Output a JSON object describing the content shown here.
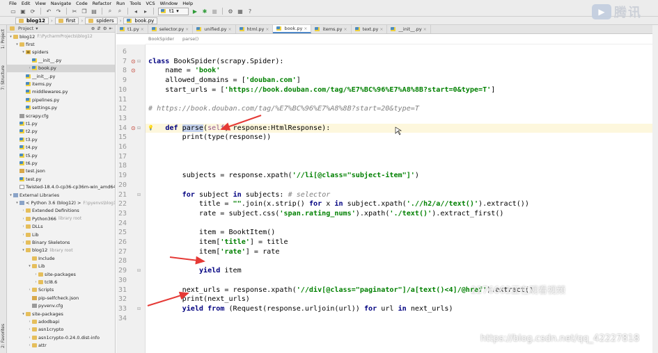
{
  "menu": [
    "File",
    "Edit",
    "View",
    "Navigate",
    "Code",
    "Refactor",
    "Run",
    "Tools",
    "VCS",
    "Window",
    "Help"
  ],
  "toolbar": {
    "run_config": "t1"
  },
  "nav": [
    "blog12",
    "first",
    "spiders",
    "book.py"
  ],
  "project": {
    "header": "Project",
    "items": [
      {
        "label": "blog12",
        "hint": "F:\\PycharmProjects\\blog12",
        "icon": "folder",
        "indent": 0,
        "arrow": "▾"
      },
      {
        "label": "first",
        "icon": "folder",
        "indent": 1,
        "arrow": "▾"
      },
      {
        "label": "spiders",
        "icon": "pkg",
        "indent": 2,
        "arrow": "▾"
      },
      {
        "label": "__init__.py",
        "icon": "py",
        "indent": 3,
        "arrow": ""
      },
      {
        "label": "book.py",
        "icon": "py",
        "indent": 3,
        "arrow": "›",
        "selected": true
      },
      {
        "label": "__init__.py",
        "icon": "py",
        "indent": 2,
        "arrow": ""
      },
      {
        "label": "items.py",
        "icon": "py",
        "indent": 2,
        "arrow": ""
      },
      {
        "label": "middlewares.py",
        "icon": "py",
        "indent": 2,
        "arrow": ""
      },
      {
        "label": "pipelines.py",
        "icon": "py",
        "indent": 2,
        "arrow": ""
      },
      {
        "label": "settings.py",
        "icon": "py",
        "indent": 2,
        "arrow": ""
      },
      {
        "label": "scrapy.cfg",
        "icon": "cfg",
        "indent": 1,
        "arrow": ""
      },
      {
        "label": "t1.py",
        "icon": "py",
        "indent": 1,
        "arrow": ""
      },
      {
        "label": "t2.py",
        "icon": "py",
        "indent": 1,
        "arrow": ""
      },
      {
        "label": "t3.py",
        "icon": "py",
        "indent": 1,
        "arrow": ""
      },
      {
        "label": "t4.py",
        "icon": "py",
        "indent": 1,
        "arrow": ""
      },
      {
        "label": "t5.py",
        "icon": "py",
        "indent": 1,
        "arrow": ""
      },
      {
        "label": "t6.py",
        "icon": "py",
        "indent": 1,
        "arrow": ""
      },
      {
        "label": "test.json",
        "icon": "json",
        "indent": 1,
        "arrow": ""
      },
      {
        "label": "test.py",
        "icon": "py",
        "indent": 1,
        "arrow": ""
      },
      {
        "label": "Twisted-18.4.0-cp36-cp36m-win_amd64.wh",
        "icon": "file",
        "indent": 1,
        "arrow": ""
      },
      {
        "label": "External Libraries",
        "icon": "lib",
        "indent": 0,
        "arrow": "▾"
      },
      {
        "label": "< Python 3.6 (blog12) >",
        "hint": "F:\\pyenvs\\blog12\\",
        "icon": "lib",
        "indent": 1,
        "arrow": "▾"
      },
      {
        "label": "Extended Definitions",
        "icon": "folder",
        "indent": 2,
        "arrow": "›"
      },
      {
        "label": "Python366",
        "hint": "library root",
        "icon": "folder",
        "indent": 2,
        "arrow": "›"
      },
      {
        "label": "DLLs",
        "icon": "folder",
        "indent": 2,
        "arrow": "›"
      },
      {
        "label": "Lib",
        "icon": "folder",
        "indent": 2,
        "arrow": "›"
      },
      {
        "label": "Binary Skeletons",
        "icon": "folder",
        "indent": 2,
        "arrow": "›"
      },
      {
        "label": "blog12",
        "hint": "library root",
        "icon": "folder",
        "indent": 2,
        "arrow": "▾"
      },
      {
        "label": "Include",
        "icon": "folder",
        "indent": 3,
        "arrow": ""
      },
      {
        "label": "Lib",
        "icon": "folder",
        "indent": 3,
        "arrow": "▾"
      },
      {
        "label": "site-packages",
        "icon": "folder",
        "indent": 4,
        "arrow": "›"
      },
      {
        "label": "tcl8.6",
        "icon": "folder",
        "indent": 4,
        "arrow": "›"
      },
      {
        "label": "Scripts",
        "icon": "folder",
        "indent": 3,
        "arrow": "›"
      },
      {
        "label": "pip-selfcheck.json",
        "icon": "json",
        "indent": 3,
        "arrow": ""
      },
      {
        "label": "pyvenv.cfg",
        "icon": "cfg",
        "indent": 3,
        "arrow": ""
      },
      {
        "label": "site-packages",
        "icon": "folder",
        "indent": 2,
        "arrow": "▾"
      },
      {
        "label": "adodbapi",
        "icon": "folder",
        "indent": 3,
        "arrow": "›"
      },
      {
        "label": "asn1crypto",
        "icon": "folder",
        "indent": 3,
        "arrow": "›"
      },
      {
        "label": "asn1crypto-0.24.0.dist-info",
        "icon": "folder",
        "indent": 3,
        "arrow": "›"
      },
      {
        "label": "attr",
        "icon": "folder",
        "indent": 3,
        "arrow": "›"
      }
    ]
  },
  "left_tabs": [
    "1: Project",
    "7: Structure",
    "2: Favorites"
  ],
  "tabs": [
    "t1.py",
    "selector.py",
    "unified.py",
    "html.py",
    "book.py",
    "items.py",
    "text.py",
    "__init__.py"
  ],
  "active_tab": 4,
  "breadcrumb2": [
    "BookSpider",
    "parse()"
  ],
  "code": {
    "lines": [
      {
        "n": "6",
        "tokens": []
      },
      {
        "n": "7",
        "tokens": [
          [
            "kw",
            "class "
          ],
          [
            "",
            "BookSpider(scrapy.Spider):"
          ]
        ]
      },
      {
        "n": "8",
        "tokens": [
          [
            "",
            "    name = "
          ],
          [
            "st",
            "'book'"
          ]
        ]
      },
      {
        "n": "9",
        "tokens": [
          [
            "",
            "    allowed_domains = ["
          ],
          [
            "st",
            "'douban.com'"
          ],
          [
            "",
            "]"
          ]
        ]
      },
      {
        "n": "10",
        "tokens": [
          [
            "",
            "    start_urls = ["
          ],
          [
            "st",
            "'https://book.douban.com/tag/%E7%BC%96%E7%A8%8B?start=0&type=T'"
          ],
          [
            "",
            "]"
          ]
        ]
      },
      {
        "n": "11",
        "tokens": []
      },
      {
        "n": "12",
        "tokens": [
          [
            "cm",
            "# https://book.douban.com/tag/%E7%BC%96%E7%A8%8B?start=20&type=T"
          ]
        ]
      },
      {
        "n": "13",
        "tokens": []
      },
      {
        "n": "14",
        "tokens": [
          [
            "",
            "    "
          ],
          [
            "kw",
            "def "
          ],
          [
            "hl",
            "parse"
          ],
          [
            "",
            "("
          ],
          [
            "sf",
            "self"
          ],
          [
            "",
            ", response:HtmlResponse):"
          ]
        ],
        "current": true
      },
      {
        "n": "15",
        "tokens": [
          [
            "",
            "        print(type(response))"
          ]
        ]
      },
      {
        "n": "16",
        "tokens": []
      },
      {
        "n": "17",
        "tokens": []
      },
      {
        "n": "18",
        "tokens": []
      },
      {
        "n": "19",
        "tokens": [
          [
            "",
            "        subjects = response.xpath("
          ],
          [
            "st",
            "'//li[@class=\"subject-item\"]'"
          ],
          [
            "",
            ")"
          ]
        ]
      },
      {
        "n": "20",
        "tokens": []
      },
      {
        "n": "21",
        "tokens": [
          [
            "",
            "        "
          ],
          [
            "kw",
            "for "
          ],
          [
            "",
            "subject "
          ],
          [
            "kw",
            "in "
          ],
          [
            "",
            "subjects: "
          ],
          [
            "cm",
            "# selector"
          ]
        ]
      },
      {
        "n": "22",
        "tokens": [
          [
            "",
            "            title = "
          ],
          [
            "st",
            "\"\""
          ],
          [
            "",
            ".join(x.strip() "
          ],
          [
            "kw",
            "for "
          ],
          [
            "",
            "x "
          ],
          [
            "kw",
            "in "
          ],
          [
            "",
            "subject.xpath("
          ],
          [
            "st",
            "'.//h2/a//text()'"
          ],
          [
            "",
            ").extract())"
          ]
        ]
      },
      {
        "n": "23",
        "tokens": [
          [
            "",
            "            rate = subject.css("
          ],
          [
            "st",
            "'span.rating_nums'"
          ],
          [
            "",
            ").xpath("
          ],
          [
            "st",
            "'./text()'"
          ],
          [
            "",
            ").extract_first()"
          ]
        ]
      },
      {
        "n": "24",
        "tokens": []
      },
      {
        "n": "25",
        "tokens": [
          [
            "",
            "            item = BooktItem()"
          ]
        ]
      },
      {
        "n": "26",
        "tokens": [
          [
            "",
            "            item["
          ],
          [
            "st",
            "'title'"
          ],
          [
            "",
            "] = title"
          ]
        ]
      },
      {
        "n": "27",
        "tokens": [
          [
            "",
            "            item["
          ],
          [
            "st",
            "'rate'"
          ],
          [
            "",
            "] = rate"
          ]
        ]
      },
      {
        "n": "28",
        "tokens": []
      },
      {
        "n": "29",
        "tokens": [
          [
            "",
            "            "
          ],
          [
            "kw",
            "yield "
          ],
          [
            "",
            "item"
          ]
        ]
      },
      {
        "n": "30",
        "tokens": []
      },
      {
        "n": "31",
        "tokens": [
          [
            "",
            "        next_urls = response.xpath("
          ],
          [
            "st",
            "'//div[@class=\"paginator\"]/a[text()<4]/@href'"
          ],
          [
            "",
            ").extract()"
          ]
        ]
      },
      {
        "n": "32",
        "tokens": [
          [
            "",
            "        print(next_urls)"
          ]
        ]
      },
      {
        "n": "33",
        "tokens": [
          [
            "",
            "        "
          ],
          [
            "kw",
            "yield from "
          ],
          [
            "",
            "(Request(response.urljoin(url)) "
          ],
          [
            "kw",
            "for "
          ],
          [
            "",
            "url "
          ],
          [
            "kw",
            "in "
          ],
          [
            "",
            "next_urls)"
          ]
        ]
      },
      {
        "n": "34",
        "tokens": []
      }
    ]
  },
  "watermarks": {
    "logo_text": "腾讯",
    "overlay": "2276662正在观看视频",
    "url": "https://blog.csdn.net/qq_42227818"
  },
  "colors": {
    "keyword": "#000080",
    "string": "#008000",
    "comment": "#808080",
    "self": "#94558d",
    "arrow": "#e53935"
  }
}
